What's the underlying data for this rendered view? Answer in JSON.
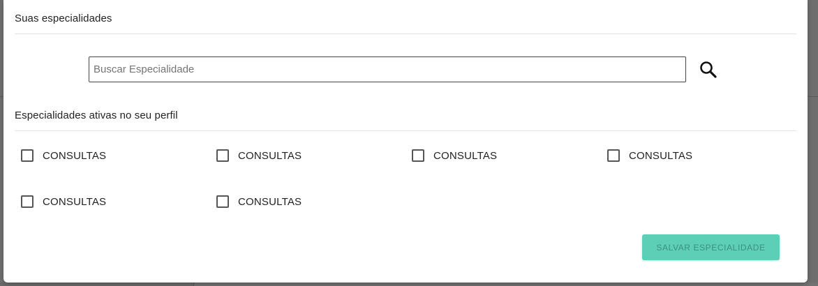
{
  "modal": {
    "title": "Suas especialidades",
    "search": {
      "placeholder": "Buscar Especialidade",
      "value": ""
    },
    "active_title": "Especialidades ativas no seu perfil",
    "specialties": [
      {
        "label": "CONSULTAS",
        "checked": false
      },
      {
        "label": "CONSULTAS",
        "checked": false
      },
      {
        "label": "CONSULTAS",
        "checked": false
      },
      {
        "label": "CONSULTAS",
        "checked": false
      },
      {
        "label": "CONSULTAS",
        "checked": false
      },
      {
        "label": "CONSULTAS",
        "checked": false
      }
    ],
    "save_label": "SALVAR ESPECIALIDADE"
  },
  "colors": {
    "save_button_bg": "#5ecfb7",
    "save_button_text": "#3d8f7e",
    "overlay": "#6e6e6e"
  },
  "icons": {
    "search": "search-icon"
  }
}
